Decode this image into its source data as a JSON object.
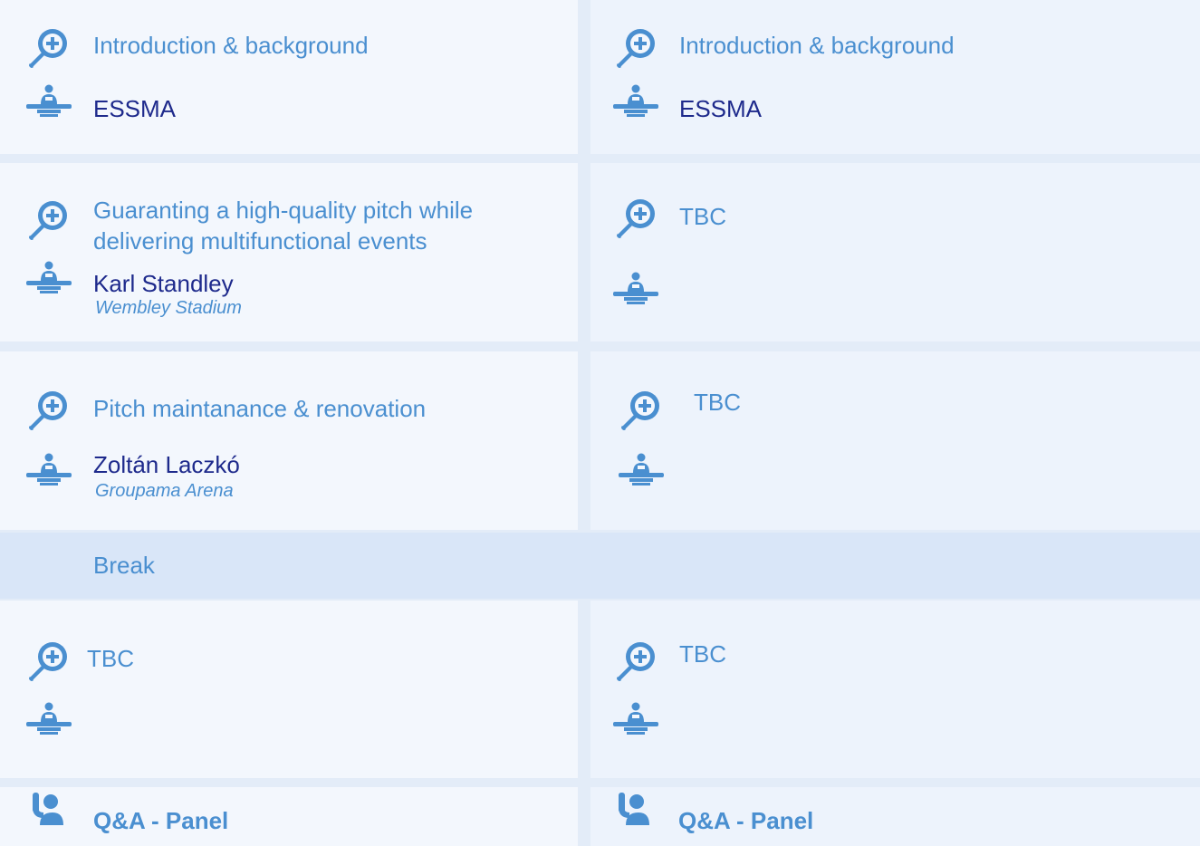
{
  "icons": {
    "topic": "magnifier-plus-icon",
    "speaker": "speaker-podium-icon",
    "qa": "raised-hand-icon"
  },
  "colors": {
    "topic_text": "#4a8fd0",
    "speaker_text": "#1e2a8c",
    "cell_bg": "#f3f7fd",
    "break_bg": "#d9e6f8"
  },
  "sessions": [
    {
      "left": {
        "topic": "Introduction & background",
        "speaker": "ESSMA",
        "org": ""
      },
      "right": {
        "topic": "Introduction & background",
        "speaker": "ESSMA",
        "org": ""
      }
    },
    {
      "left": {
        "topic_line1": "Guaranting a high-quality pitch while",
        "topic_line2": "delivering multifunctional events",
        "speaker": "Karl Standley",
        "org": "Wembley Stadium"
      },
      "right": {
        "topic": "TBC",
        "speaker": "",
        "org": ""
      }
    },
    {
      "left": {
        "topic": "Pitch maintanance & renovation",
        "speaker": "Zoltán Laczkó",
        "org": "Groupama Arena"
      },
      "right": {
        "topic": "TBC",
        "speaker": "",
        "org": ""
      }
    },
    {
      "left": {
        "topic": "TBC",
        "speaker": "",
        "org": ""
      },
      "right": {
        "topic": "TBC",
        "speaker": "",
        "org": ""
      }
    }
  ],
  "break_label": "Break",
  "qa": {
    "left": "Q&A - Panel",
    "right": "Q&A - Panel"
  }
}
